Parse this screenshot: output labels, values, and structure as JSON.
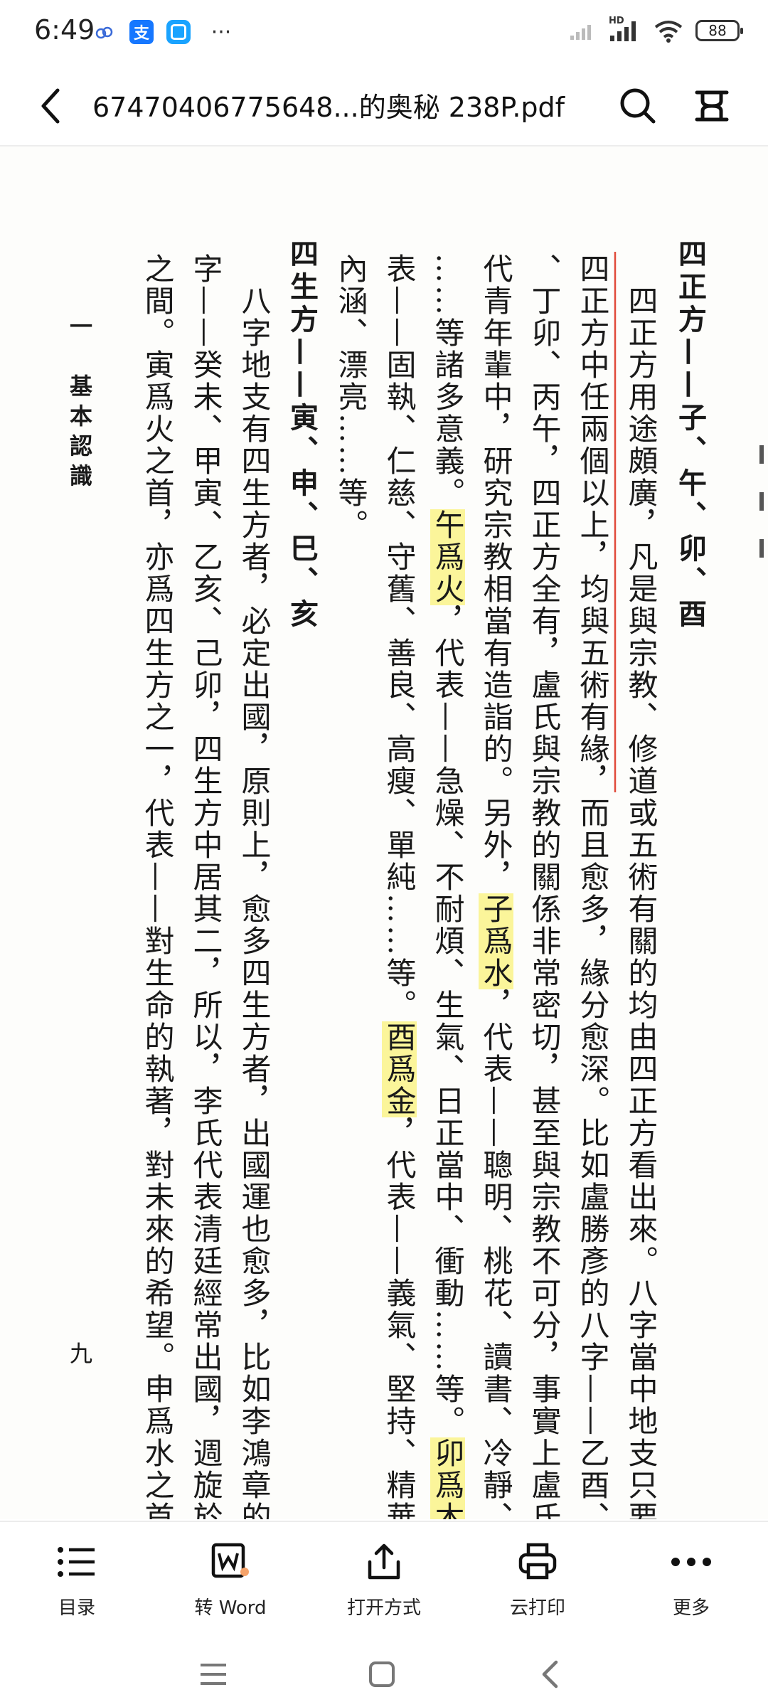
{
  "status_bar": {
    "time": "6:49",
    "notification_icons": [
      "cloud-icon",
      "alipay-icon",
      "app-icon",
      "more-dots-icon"
    ],
    "alipay_glyph": "支",
    "more_text": "···",
    "signal_label": "HD",
    "battery": "88"
  },
  "title_bar": {
    "title": "67470406775648...的奥秘  238P.pdf"
  },
  "document": {
    "text_color": "#1a1a1a",
    "highlight_color": "#fbf59a",
    "annotation_color": "#e04a3a",
    "heading1": "四正方——子、午、卯、酉",
    "para1": [
      "　四正方用途頗廣，凡是與宗教、修道或五術有關的均由四正方看出來。八字當中地支只要有",
      "四正方中任兩個以上，均與五術有緣，而且愈多，緣分愈深。比如盧勝彥的八字——乙酉、壬午",
      "、丁卯、丙午，四正方全有，盧氏與宗教的關係非常密切，甚至與宗教不可分，事實上盧氏是近",
      "代青年輩中，研究宗教相當有造詣的。另外，子爲水，代表——聰明、桃花、讀書、冷靜、智慧",
      "……等諸多意義。午爲火，代表——急燥、不耐煩、生氣、日正當中、衝動……等。卯爲木，代",
      "表——固執、仁慈、守舊、善良、高瘦、單純……等。酉爲金，代表——義氣、堅持、精華、有",
      "內涵、漂亮……等。"
    ],
    "heading2": "四生方——寅、申、巳、亥",
    "para2": [
      "　八字地支有四生方者，必定出國，原則上，愈多四生方者，出國運也愈多，比如李鴻章的八",
      "字——癸未、甲寅、乙亥、己卯，四生方中居其二，所以，李氏代表清廷經常出國，週旋於列强",
      "之間。寅爲火之首，亦爲四生方之一，代表——對生命的執著，對未來的希望。申爲水之首，亦"
    ],
    "chapter_title": "一　基本認識",
    "page_number": "九"
  },
  "toolbar": {
    "items": [
      {
        "label": "目录",
        "icon": "list-icon"
      },
      {
        "label": "转 Word",
        "icon": "convert-word-icon"
      },
      {
        "label": "打开方式",
        "icon": "share-icon"
      },
      {
        "label": "云打印",
        "icon": "printer-icon"
      },
      {
        "label": "更多",
        "icon": "more-icon"
      }
    ]
  },
  "nav_bar": {
    "icons": [
      "menu-icon",
      "home-icon",
      "back-icon"
    ]
  }
}
